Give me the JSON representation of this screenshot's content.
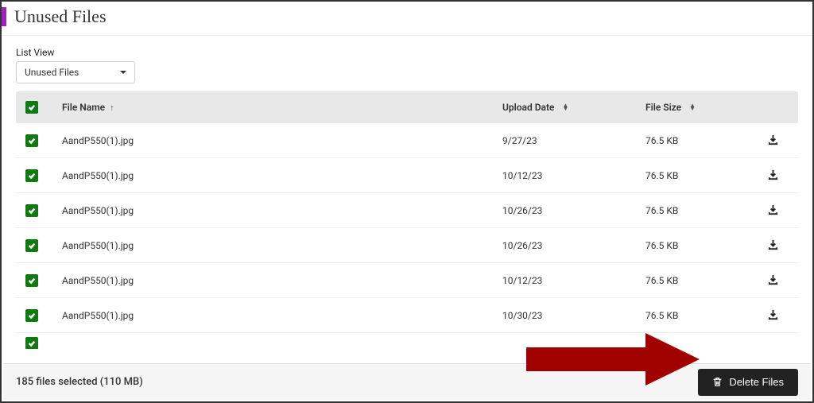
{
  "header": {
    "title": "Unused Files"
  },
  "listView": {
    "label": "List View",
    "selected": "Unused Files"
  },
  "table": {
    "columns": {
      "name": "File Name",
      "date": "Upload Date",
      "size": "File Size"
    },
    "rows": [
      {
        "name": "AandP550(1).jpg",
        "date": "9/27/23",
        "size": "76.5 KB"
      },
      {
        "name": "AandP550(1).jpg",
        "date": "10/12/23",
        "size": "76.5 KB"
      },
      {
        "name": "AandP550(1).jpg",
        "date": "10/26/23",
        "size": "76.5 KB"
      },
      {
        "name": "AandP550(1).jpg",
        "date": "10/26/23",
        "size": "76.5 KB"
      },
      {
        "name": "AandP550(1).jpg",
        "date": "10/12/23",
        "size": "76.5 KB"
      },
      {
        "name": "AandP550(1).jpg",
        "date": "10/30/23",
        "size": "76.5 KB"
      }
    ]
  },
  "footer": {
    "selectedText": "185 files selected (110 MB)",
    "deleteLabel": "Delete Files"
  }
}
